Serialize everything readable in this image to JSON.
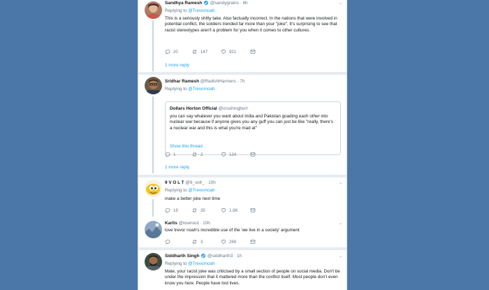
{
  "tweets": [
    {
      "name": "Sandhya Ramesh",
      "verified": true,
      "handle": "@sandygrains",
      "time": "6h",
      "reply_prefix": "Replying to",
      "reply_to": "@Trevornoah",
      "text": "This is a seriously shitty take. Also factually incorrect. In the nations that were involved in potential conflict, the soldiers trended far more than your \"joke\". It's surprising to see that racist stereotypes aren't a problem for you when it comes to other cultures.",
      "replies": "20",
      "retweets": "147",
      "likes": "921",
      "more_replies": "1 more reply"
    },
    {
      "name": "Sridhar Ramesh",
      "handle": "@RadishHarmers",
      "time": "7h",
      "reply_prefix": "Replying to",
      "reply_to": "@Trevornoah",
      "quote": {
        "name": "Dollars Horton Official",
        "handle": "@crushingbort",
        "text": "you can say whatever you want about India and Pakistan goading each other into nuclear war because if anyone gives you any guff you can just be like \"really, there's a nuclear war and this is what you're mad at\"",
        "show_thread": "Show this thread"
      },
      "replies": "1",
      "retweets": "2",
      "likes": "124",
      "more_replies": "1 more reply"
    },
    {
      "name": "9 V O L T",
      "handle": "@9_volt_",
      "time": "10h",
      "reply_prefix": "Replying to",
      "reply_to": "@Trevornoah",
      "text": "make a better joke next time",
      "replies": "19",
      "retweets": "35",
      "likes": "1.8K"
    },
    {
      "name": "Karlis",
      "handle": "@townout",
      "time": "10h",
      "text": "love trevor noah's incredible use of the 'we live in a society' argument",
      "replies": "",
      "retweets": "3",
      "likes": "269"
    },
    {
      "name": "Siddharth Singh",
      "verified": true,
      "handle": "@siddharth3",
      "time": "1h",
      "reply_prefix": "Replying to",
      "reply_to": "@Trevornoah",
      "text": "Mate, your racist joke was criticised by a small section of people on social media. Don't be under the impression that it mattered more than the conflict itself. Most people don't even know you here. People have lost lives."
    }
  ],
  "separator": "·",
  "icons": {
    "reply": "reply-icon",
    "retweet": "retweet-icon",
    "like": "heart-icon",
    "dm": "envelope-icon",
    "chevron": "chevron-down-icon",
    "verified": "verified-badge-icon"
  },
  "colors": {
    "background": "#4a77a8",
    "link": "#1da1f2",
    "muted": "#657786",
    "thread_line": "#cbd5df"
  }
}
